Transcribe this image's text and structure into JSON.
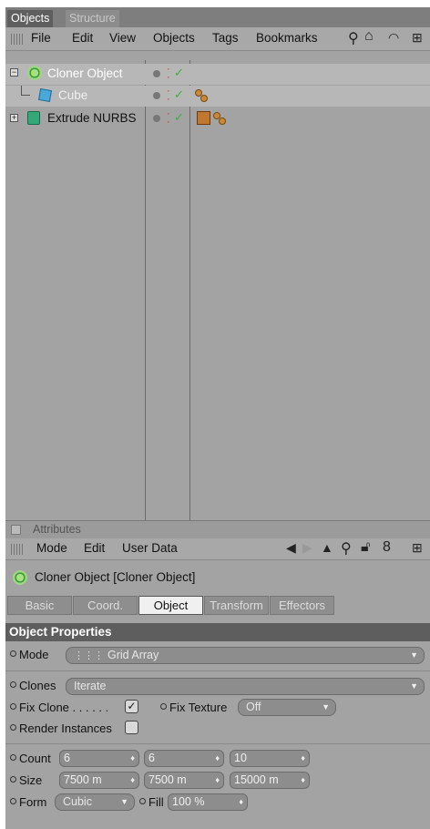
{
  "objects_manager": {
    "tabs": [
      "Objects",
      "Structure"
    ],
    "menu": [
      "File",
      "Edit",
      "View",
      "Objects",
      "Tags",
      "Bookmarks"
    ],
    "toolbar_icons": [
      "search-icon",
      "home-icon",
      "eye-icon",
      "new-window-icon"
    ],
    "items": [
      {
        "name": "Cloner Object",
        "icon": "cloner-icon",
        "selected": true
      },
      {
        "name": "Cube",
        "icon": "cube-icon",
        "selected": true,
        "tags": [
          "texture-tag-icon"
        ]
      },
      {
        "name": "Extrude NURBS",
        "icon": "extrude-icon",
        "selected": false,
        "tags": [
          "uvw-tag-icon",
          "texture-tag-icon"
        ]
      }
    ]
  },
  "attributes_manager": {
    "title": "Attributes",
    "menu": [
      "Mode",
      "Edit",
      "User Data"
    ],
    "toolbar_icons": [
      "back-arrow-icon",
      "forward-arrow-icon",
      "up-arrow-icon",
      "search-icon",
      "lock-icon",
      "link-icon",
      "new-window-icon"
    ],
    "object_title": "Cloner Object [Cloner Object]",
    "tabs": [
      "Basic",
      "Coord.",
      "Object",
      "Transform",
      "Effectors"
    ],
    "active_tab": "Object",
    "section": "Object Properties",
    "mode": {
      "label": "Mode",
      "value": "Grid Array"
    },
    "clones": {
      "label": "Clones",
      "value": "Iterate"
    },
    "fix_clone": {
      "label": "Fix Clone . . . . . .",
      "checked": true
    },
    "fix_texture": {
      "label": "Fix Texture",
      "value": "Off"
    },
    "render_instances": {
      "label": "Render Instances",
      "checked": false
    },
    "count": {
      "label": "Count",
      "values": [
        "6",
        "6",
        "10"
      ]
    },
    "size": {
      "label": "Size",
      "values": [
        "7500 m",
        "7500 m",
        "15000 m"
      ]
    },
    "form": {
      "label": "Form",
      "value": "Cubic"
    },
    "fill": {
      "label": "Fill",
      "value": "100 %"
    }
  },
  "colors": {
    "panel": "#a3a3a3",
    "section_header": "#5e5e5e",
    "active_tab": "#f0f0f0",
    "field": "#8d8d8d"
  }
}
